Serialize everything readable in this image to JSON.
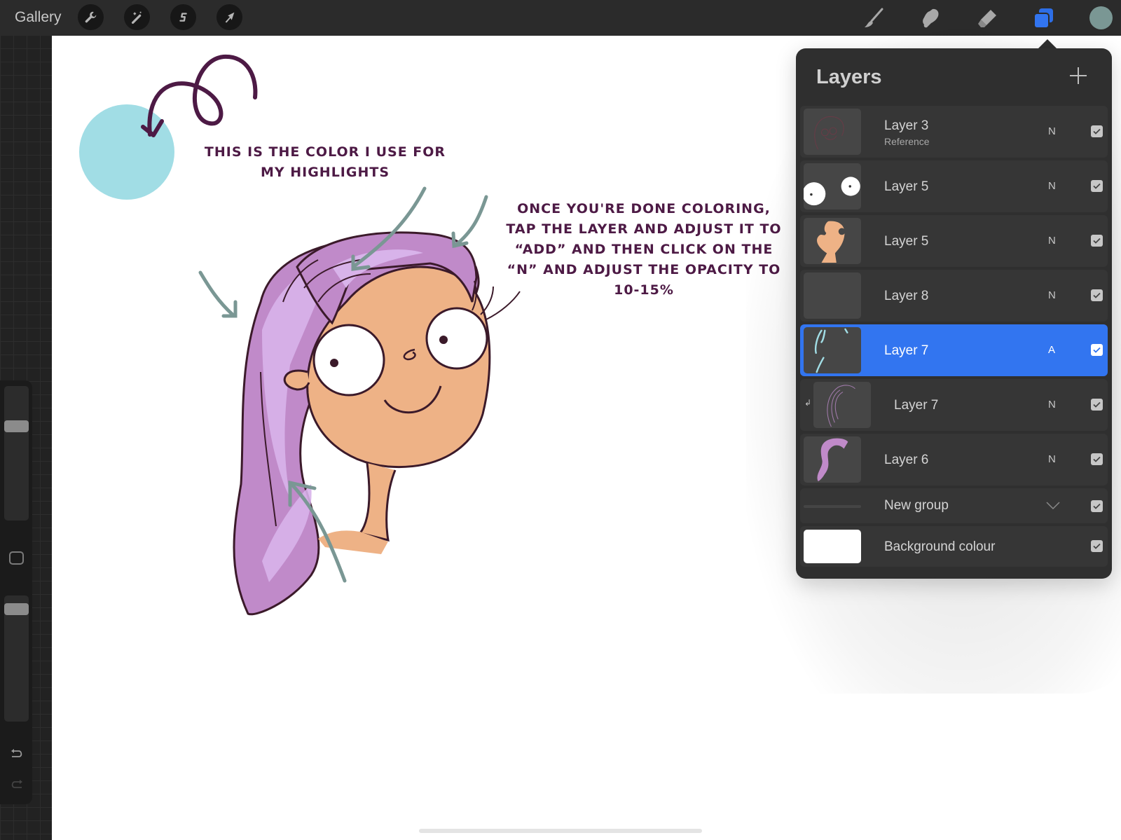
{
  "topbar": {
    "gallery_label": "Gallery",
    "left_tools": [
      {
        "name": "actions",
        "icon": "wrench-icon"
      },
      {
        "name": "adjustments",
        "icon": "magic-wand-icon"
      },
      {
        "name": "selection",
        "icon": "selection-s-icon"
      },
      {
        "name": "transform",
        "icon": "arrow-cursor-icon"
      }
    ],
    "right_tools": [
      {
        "name": "brush",
        "icon": "brush-icon",
        "active": false
      },
      {
        "name": "smudge",
        "icon": "smudge-finger-icon",
        "active": false
      },
      {
        "name": "eraser",
        "icon": "eraser-icon",
        "active": false
      },
      {
        "name": "layers",
        "icon": "layers-icon",
        "active": true
      }
    ],
    "current_color": "#7a9794",
    "accent_color": "#3275f0"
  },
  "canvas": {
    "highlight_swatch_color": "#a1dde5",
    "note_1": "This is the color I use for my highlights",
    "note_2": "Once you're done coloring, tap the layer and adjust it to “ADD” and then click on the “N” and adjust the opacity to 10-15%"
  },
  "sidebar": {
    "brush_size_level": 0.72,
    "opacity_level": 0.93,
    "modify_button_icon": "square-icon",
    "undo_icon": "undo-icon",
    "redo_icon": "redo-icon"
  },
  "layers_panel": {
    "title": "Layers",
    "add_icon": "plus-icon",
    "layers": [
      {
        "name": "Layer 3",
        "subtitle": "Reference",
        "blend": "N",
        "visible": true,
        "selected": false,
        "clipped": false,
        "thumb": "sketch"
      },
      {
        "name": "Layer 5",
        "blend": "N",
        "visible": true,
        "selected": false,
        "clipped": false,
        "thumb": "eyes"
      },
      {
        "name": "Layer 5",
        "blend": "N",
        "visible": true,
        "selected": false,
        "clipped": false,
        "thumb": "skin"
      },
      {
        "name": "Layer 8",
        "blend": "N",
        "visible": true,
        "selected": false,
        "clipped": false,
        "thumb": "empty"
      },
      {
        "name": "Layer 7",
        "blend": "A",
        "visible": true,
        "selected": true,
        "clipped": false,
        "thumb": "highlights"
      },
      {
        "name": "Layer 7",
        "blend": "N",
        "visible": true,
        "selected": false,
        "clipped": true,
        "thumb": "hairlines"
      },
      {
        "name": "Layer 6",
        "blend": "N",
        "visible": true,
        "selected": false,
        "clipped": false,
        "thumb": "hair"
      }
    ],
    "group": {
      "name": "New group",
      "visible": true,
      "expanded": true
    },
    "background": {
      "name": "Background colour",
      "color": "#ffffff",
      "visible": true
    }
  }
}
